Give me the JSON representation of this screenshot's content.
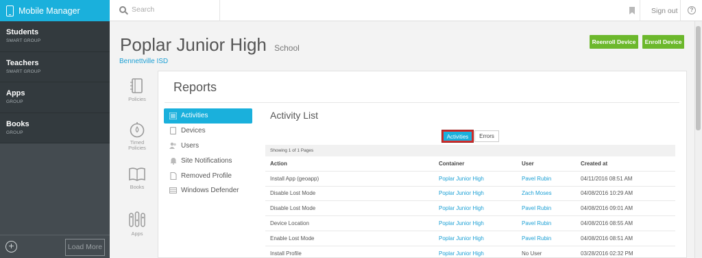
{
  "app": {
    "title": "Mobile Manager"
  },
  "sidebar": {
    "items": [
      {
        "name": "Students",
        "type": "SMART GROUP"
      },
      {
        "name": "Teachers",
        "type": "SMART GROUP"
      },
      {
        "name": "Apps",
        "type": "GROUP"
      },
      {
        "name": "Books",
        "type": "GROUP"
      }
    ],
    "load_more": "Load More"
  },
  "topbar": {
    "search_placeholder": "Search",
    "sign_out": "Sign out"
  },
  "header": {
    "school_name": "Poplar Junior High",
    "school_suffix": "School",
    "district": "Bennettville ISD",
    "reenroll_button": "Reenroll Device",
    "enroll_button": "Enroll Device"
  },
  "rail": [
    {
      "label": "Policies",
      "icon": "policies-icon"
    },
    {
      "label": "Timed Policies",
      "icon": "timed-policies-icon"
    },
    {
      "label": "Books",
      "icon": "books-icon"
    },
    {
      "label": "Apps",
      "icon": "apps-icon"
    }
  ],
  "reports": {
    "title": "Reports",
    "nav": [
      {
        "label": "Activities",
        "icon": "list-icon",
        "active": true
      },
      {
        "label": "Devices",
        "icon": "device-icon"
      },
      {
        "label": "Users",
        "icon": "users-icon"
      },
      {
        "label": "Site Notifications",
        "icon": "bell-icon"
      },
      {
        "label": "Removed Profile",
        "icon": "removed-profile-icon"
      },
      {
        "label": "Windows Defender",
        "icon": "windows-defender-icon"
      }
    ]
  },
  "activity": {
    "title": "Activity List",
    "toggle": {
      "activities": "Activities",
      "errors": "Errors",
      "selected": "Activities"
    },
    "pages_text": "Showing 1 of 1 Pages",
    "columns": [
      "Action",
      "Container",
      "User",
      "Created at"
    ],
    "rows": [
      [
        "Install App (geoapp)",
        "Poplar Junior High",
        "Pavel Rubin",
        "04/11/2016 08:51 AM"
      ],
      [
        "Disable Lost Mode",
        "Poplar Junior High",
        "Zach Moses",
        "04/08/2016 10:29 AM"
      ],
      [
        "Disable Lost Mode",
        "Poplar Junior High",
        "Pavel Rubin",
        "04/08/2016 09:01 AM"
      ],
      [
        "Device Location",
        "Poplar Junior High",
        "Pavel Rubin",
        "04/08/2016 08:55 AM"
      ],
      [
        "Enable Lost Mode",
        "Poplar Junior High",
        "Pavel Rubin",
        "04/08/2016 08:51 AM"
      ],
      [
        "Install Profile",
        "Poplar Junior High",
        "No User",
        "03/28/2016 02:32 PM"
      ]
    ]
  },
  "colors": {
    "accent": "#1ab0dc",
    "sidebar": "#444b50",
    "green": "#6cb82c",
    "highlight": "#d42a2a"
  }
}
